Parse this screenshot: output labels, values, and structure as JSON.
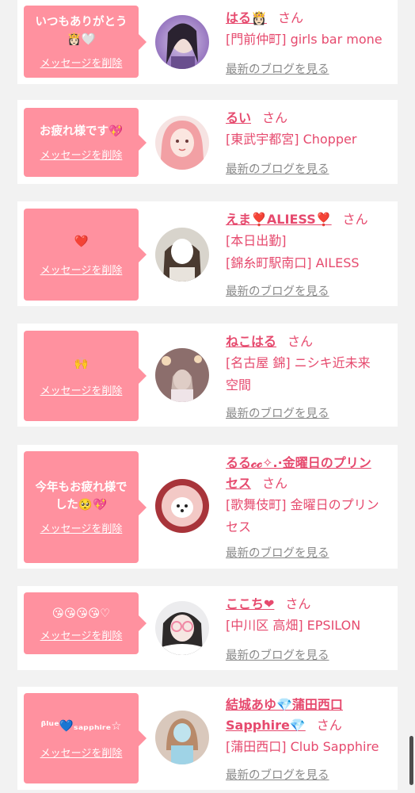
{
  "colors": {
    "bubble": "#ff919f",
    "name": "#e64a6e",
    "blog_link": "#8a8a8a",
    "background": "#f2f2f2"
  },
  "items": [
    {
      "message": "いつもありがとう\n👸🏻🤍",
      "delete_label": "メッセージを削除",
      "name": "はる👸🏻",
      "honorific": "さん",
      "shop": "[門前仲町] girls bar mone",
      "blog_label": "最新のブログを見る",
      "avatar_icon": "girl-selfie-purple-icon"
    },
    {
      "message": "お疲れ様です💖",
      "delete_label": "メッセージを削除",
      "name": "るい",
      "honorific": "さん",
      "shop": "[東武宇都宮] Chopper",
      "blog_label": "最新のブログを見る",
      "avatar_icon": "girl-pink-hair-icon"
    },
    {
      "message": "❤️",
      "delete_label": "メッセージを削除",
      "name": "えま❣️ALIESS❣️",
      "honorific": "さん",
      "shop": "[本日出勤]\n[錦糸町駅南口] AILESS",
      "blog_label": "最新のブログを見る",
      "avatar_icon": "girl-hidden-face-icon"
    },
    {
      "message": "🙌",
      "delete_label": "メッセージを削除",
      "name": "ねこはる",
      "honorific": "さん",
      "shop": "[名古屋 錦] ニシキ近未来\n空間",
      "blog_label": "最新のブログを見る",
      "avatar_icon": "girl-lounge-icon"
    },
    {
      "message": "今年もお疲れ様で\nした🥺💖",
      "delete_label": "メッセージを削除",
      "name": "るる𝓬𝓬✧.·金曜日のプリン\nセス",
      "honorific": "さん",
      "shop": "[歌舞伎町] 金曜日のプリン\nセス",
      "blog_label": "最新のブログを見る",
      "avatar_icon": "girl-white-dog-icon"
    },
    {
      "message": "😘😘😘😘♡",
      "delete_label": "メッセージを削除",
      "name": "ここち❤",
      "honorific": "さん",
      "shop": "[中川区 高畑] EPSILON",
      "blog_label": "最新のブログを見る",
      "avatar_icon": "girl-hello-kitty-glasses-icon"
    },
    {
      "message": "ᵝˡᵘᵉ💙ₛₐₚₚₕᵢᵣₑ☆",
      "delete_label": "メッセージを削除",
      "name": "結城あゆ💎蒲田西口\nSapphire💎",
      "honorific": "さん",
      "shop": "[蒲田西口] Club Sapphire",
      "blog_label": "最新のブログを見る",
      "avatar_icon": "girl-blue-dress-icon"
    }
  ]
}
